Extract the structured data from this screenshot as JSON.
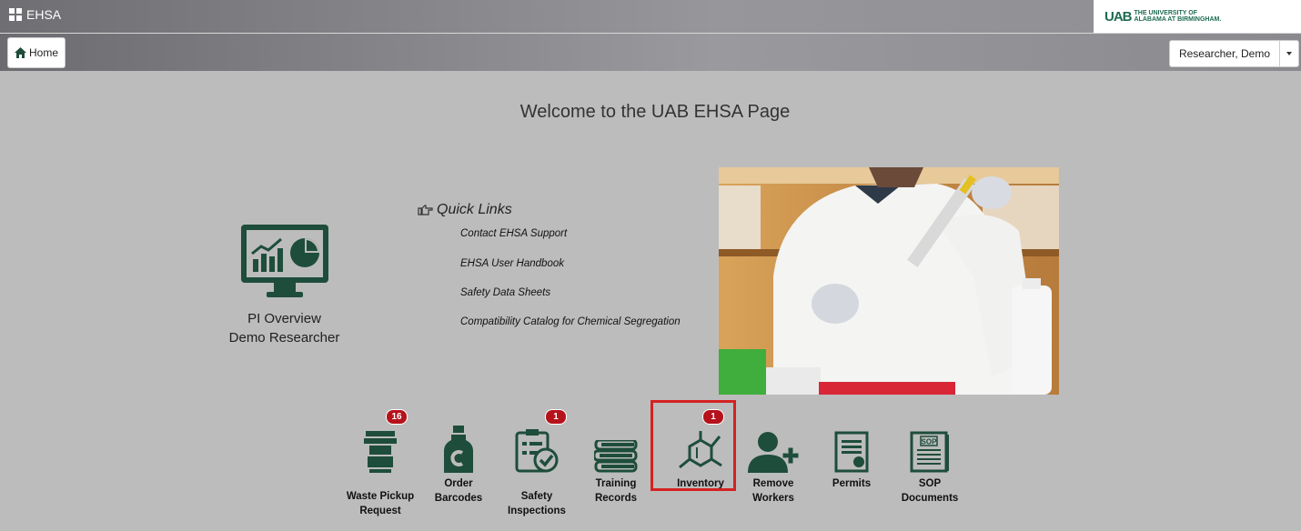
{
  "header": {
    "app_title": "EHSA",
    "logo_mark": "UAB",
    "logo_text_line1": "THE UNIVERSITY OF",
    "logo_text_line2": "ALABAMA AT BIRMINGHAM."
  },
  "navbar": {
    "home_label": "Home",
    "user_label": "Researcher, Demo"
  },
  "main": {
    "welcome": "Welcome to the UAB EHSA Page",
    "pi_overview": {
      "line1": "PI Overview",
      "line2": "Demo Researcher"
    },
    "quick_links": {
      "title": "Quick Links",
      "links": [
        "Contact EHSA Support",
        "EHSA User Handbook",
        "Safety Data Sheets",
        "Compatibility Catalog for Chemical Segregation"
      ]
    }
  },
  "tiles": [
    {
      "label_line1": "Waste Pickup",
      "label_line2": "Request",
      "badge": "16",
      "icon": "waste-container-icon"
    },
    {
      "label_line1": "Order",
      "label_line2": "Barcodes",
      "badge": "",
      "icon": "bottle-icon"
    },
    {
      "label_line1": "Safety",
      "label_line2": "Inspections",
      "badge": "1",
      "icon": "checklist-icon"
    },
    {
      "label_line1": "Training",
      "label_line2": "Records",
      "badge": "",
      "icon": "books-icon"
    },
    {
      "label_line1": "Inventory",
      "label_line2": "",
      "badge": "1",
      "icon": "molecule-icon"
    },
    {
      "label_line1": "Remove",
      "label_line2": "Workers",
      "badge": "",
      "icon": "add-user-icon"
    },
    {
      "label_line1": "Permits",
      "label_line2": "",
      "badge": "",
      "icon": "permit-icon"
    },
    {
      "label_line1": "SOP",
      "label_line2": "Documents",
      "badge": "",
      "icon": "sop-document-icon",
      "icon_text": "SOP"
    }
  ],
  "colors": {
    "brand_green": "#1e4d3b",
    "badge_red": "#b5121b",
    "highlight_red": "#d42222",
    "background": "#bcbcbc"
  }
}
